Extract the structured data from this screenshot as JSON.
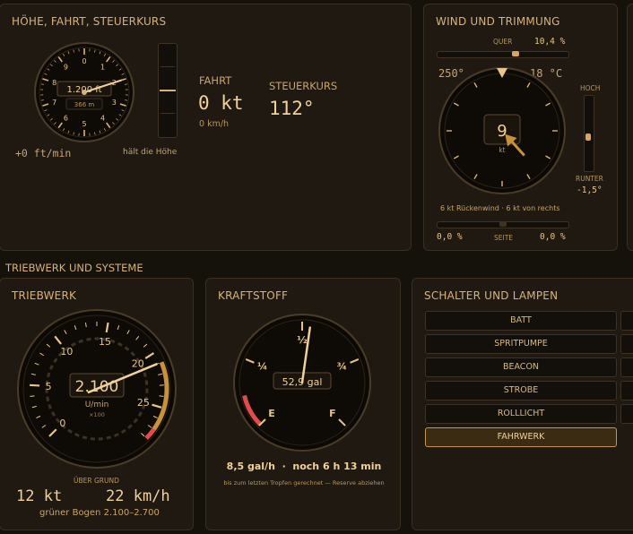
{
  "panels": {
    "altitude": {
      "title": "HÖHE, FAHRT, STEUERKURS",
      "dial_numbers": [
        "0",
        "1",
        "2",
        "3",
        "4",
        "5",
        "6",
        "7",
        "8",
        "9"
      ],
      "altitude_ft": "1.200 ft",
      "altitude_m": "366 m",
      "vs_readout": "+0 ft/min",
      "hold_status": "hält die Höhe",
      "speed_label": "FAHRT",
      "speed_kt": "0 kt",
      "speed_kmh": "0 km/h",
      "heading_label": "STEUERKURS",
      "heading_value": "112°"
    },
    "wind": {
      "title": "WIND UND TRIMMUNG",
      "quer_label": "QUER",
      "quer_value": "10,4 %",
      "direction": "250°",
      "temperature": "18 °C",
      "speed": "9",
      "speed_unit": "kt",
      "hoch_label": "HOCH",
      "runter_label": "RUNTER",
      "trim_value": "-1,5°",
      "components": "6 kt Rückenwind · 6 kt von rechts",
      "seite_label": "SEITE",
      "seite_left": "0,0 %",
      "seite_right": "0,0 %"
    },
    "systems_section": "TRIEBWERK UND SYSTEME",
    "engine": {
      "title": "TRIEBWERK",
      "dial_numbers": [
        "0",
        "5",
        "10",
        "15",
        "20",
        "25"
      ],
      "rpm": "2.100",
      "rpm_unit": "U/min",
      "rpm_mult": "×100",
      "ground_label": "ÜBER GRUND",
      "ground_kt": "12 kt",
      "ground_kmh": "22 km/h",
      "green_arc": "grüner Bogen 2.100–2.700"
    },
    "fuel": {
      "title": "KRAFTSTOFF",
      "marks": [
        "E",
        "¼",
        "½",
        "¾",
        "F"
      ],
      "quantity": "52,9 gal",
      "flow": "8,5 gal/h  ·  noch 6 h 13 min",
      "note": "bis zum letzten Tropfen gerechnet — Reserve abziehen"
    },
    "switches": {
      "title": "SCHALTER UND LAMPEN",
      "items": [
        {
          "label": "BATT",
          "on": false
        },
        {
          "label": "SPRITPUMPE",
          "on": false
        },
        {
          "label": "BEACON",
          "on": false
        },
        {
          "label": "STROBE",
          "on": false
        },
        {
          "label": "ROLLLICHT",
          "on": false
        },
        {
          "label": "FAHRWERK",
          "on": true
        }
      ]
    }
  },
  "gauges": {
    "altimeter_fraction": 0.2,
    "vsi_fraction": 0.5,
    "quer_fraction": 0.6,
    "trim_fraction": 0.55,
    "seite_fraction": 0.5,
    "wind_arrow_deg": 138,
    "rpm_value": 2100,
    "rpm_max": 2800,
    "fuel_fraction": 0.53
  },
  "colors": {
    "accent": "#e8c68a",
    "needle": "#f2d09a",
    "redline": "#e04b4b",
    "amber_arc": "#c8913c",
    "switch_on_border": "#c99548"
  }
}
